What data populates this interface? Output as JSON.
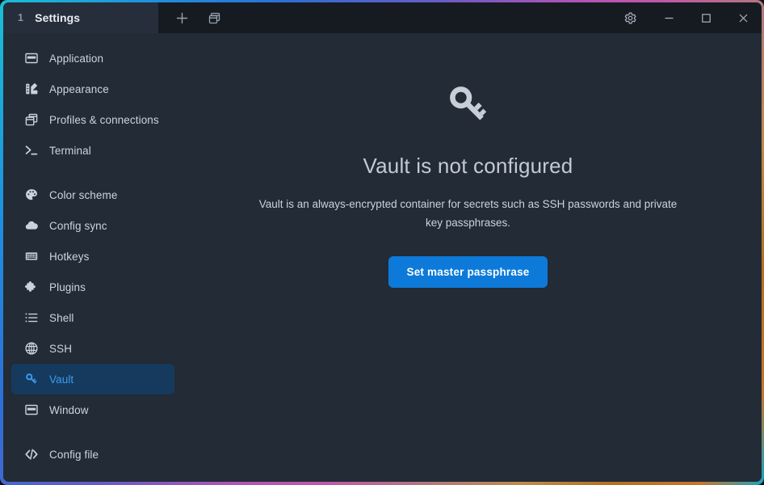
{
  "titlebar": {
    "tab": {
      "index": "1",
      "title": "Settings"
    },
    "tools": [
      {
        "name": "new-tab-button",
        "icon": "plus-icon",
        "label": "+"
      },
      {
        "name": "split-pane-button",
        "icon": "window-copy-icon",
        "label": ""
      }
    ],
    "window_controls": [
      {
        "name": "settings-gear-button",
        "icon": "gear-icon"
      },
      {
        "name": "minimize-button",
        "icon": "minimize-icon"
      },
      {
        "name": "maximize-button",
        "icon": "maximize-icon"
      },
      {
        "name": "close-button",
        "icon": "close-icon"
      }
    ]
  },
  "sidebar": {
    "groups": [
      {
        "items": [
          {
            "label": "Application",
            "icon": "window-icon",
            "active": false
          },
          {
            "label": "Appearance",
            "icon": "swatchbook-icon",
            "active": false
          },
          {
            "label": "Profiles & connections",
            "icon": "copy-windows-icon",
            "active": false
          },
          {
            "label": "Terminal",
            "icon": "terminal-prompt-icon",
            "active": false
          }
        ]
      },
      {
        "items": [
          {
            "label": "Color scheme",
            "icon": "palette-icon",
            "active": false
          },
          {
            "label": "Config sync",
            "icon": "cloud-icon",
            "active": false
          },
          {
            "label": "Hotkeys",
            "icon": "keyboard-icon",
            "active": false
          },
          {
            "label": "Plugins",
            "icon": "puzzle-piece-icon",
            "active": false
          },
          {
            "label": "Shell",
            "icon": "list-icon",
            "active": false
          },
          {
            "label": "SSH",
            "icon": "globe-icon",
            "active": false
          },
          {
            "label": "Vault",
            "icon": "key-icon",
            "active": true
          },
          {
            "label": "Window",
            "icon": "window-icon",
            "active": false
          }
        ]
      },
      {
        "items": [
          {
            "label": "Config file",
            "icon": "code-brackets-icon",
            "active": false
          }
        ]
      }
    ]
  },
  "main": {
    "hero_icon": "key-icon",
    "heading": "Vault is not configured",
    "description": "Vault is an always-encrypted container for secrets such as SSH passwords and private key passphrases.",
    "primary_button": "Set master passphrase"
  },
  "colors": {
    "accent": "#0d7ada",
    "active_nav_bg": "#153a5e",
    "active_nav_text": "#3b9bf0",
    "window_bg": "#222b36",
    "titlebar_bg": "#161b22",
    "tab_bg": "#252e3a"
  }
}
